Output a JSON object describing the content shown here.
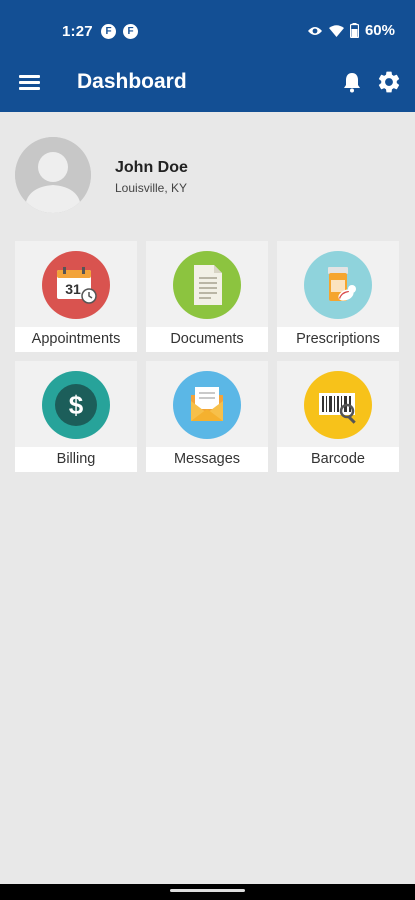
{
  "status_bar": {
    "time": "1:27",
    "battery": "60%",
    "notification_icons": [
      "f-badge-icon",
      "f-badge-icon"
    ],
    "system_icons": [
      "eye-icon",
      "wifi-icon",
      "battery-icon"
    ]
  },
  "app_bar": {
    "title": "Dashboard",
    "color": "#134f94",
    "actions": [
      "bell-icon",
      "gear-icon"
    ]
  },
  "profile": {
    "name": "John Doe",
    "location": "Louisville, KY"
  },
  "tiles": [
    {
      "label": "Appointments",
      "icon": "calendar-icon",
      "color": "#d9534f"
    },
    {
      "label": "Documents",
      "icon": "document-icon",
      "color": "#8cc43f"
    },
    {
      "label": "Prescriptions",
      "icon": "pill-bottle-icon",
      "color": "#8fd3dc"
    },
    {
      "label": "Billing",
      "icon": "dollar-icon",
      "color": "#27a39a"
    },
    {
      "label": "Messages",
      "icon": "envelope-icon",
      "color": "#5bb7e6"
    },
    {
      "label": "Barcode",
      "icon": "barcode-scan-icon",
      "color": "#f7c21a"
    }
  ],
  "calendar_day": "31"
}
